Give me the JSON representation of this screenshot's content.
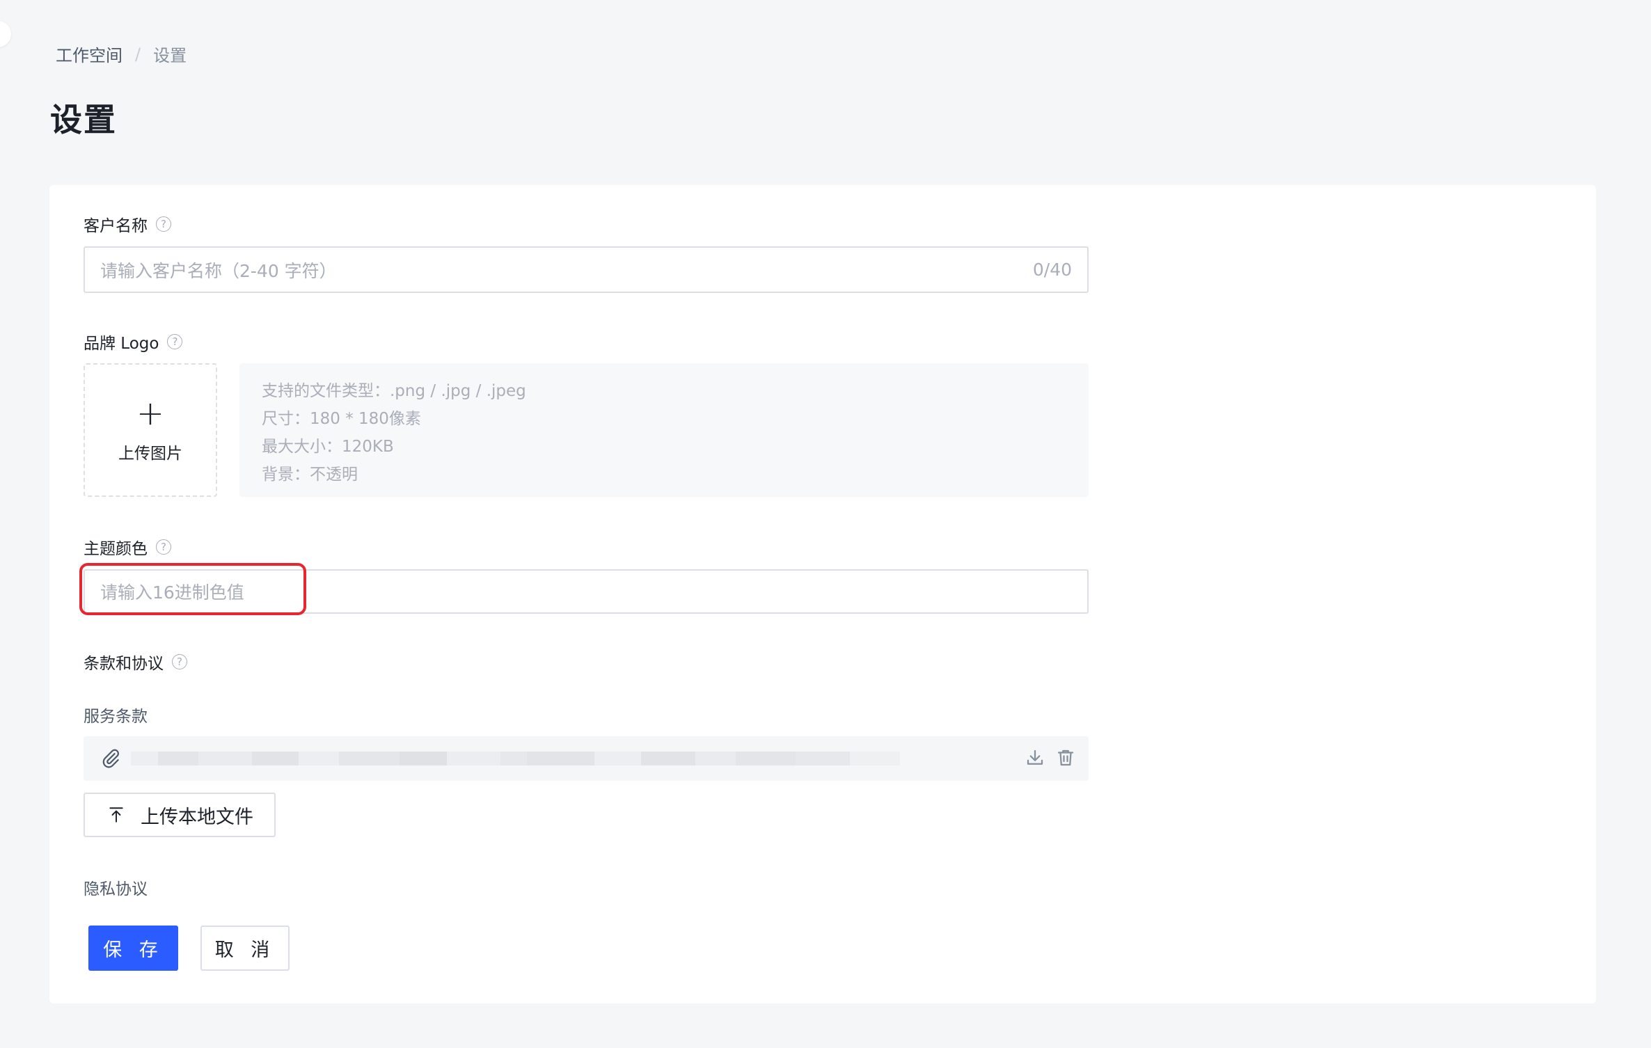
{
  "breadcrumb": {
    "root": "工作空间",
    "separator": "/",
    "current": "设置"
  },
  "page_title": "设置",
  "form": {
    "customer_name": {
      "label": "客户名称",
      "placeholder": "请输入客户名称（2-40 字符）",
      "counter": "0/40"
    },
    "brand_logo": {
      "label": "品牌 Logo",
      "upload_plus": "+",
      "upload_label": "上传图片",
      "tips": [
        "支持的文件类型：.png / .jpg / .jpeg",
        "尺寸：180 * 180像素",
        "最大大小：120KB",
        "背景：不透明"
      ]
    },
    "theme_color": {
      "label": "主题颜色",
      "placeholder": "请输入16进制色值"
    },
    "terms": {
      "label": "条款和协议",
      "service_terms_label": "服务条款",
      "upload_button_label": "上传本地文件",
      "privacy_label": "隐私协议"
    }
  },
  "actions": {
    "save_label": "保 存",
    "cancel_label": "取 消"
  },
  "colors": {
    "primary": "#2b5cff",
    "highlight": "#e8262f",
    "background": "#f5f6f8"
  },
  "icons": {
    "help": "question-circle-icon",
    "attachment": "paperclip-icon",
    "download": "download-icon",
    "delete": "trash-icon",
    "upload": "upload-icon"
  },
  "help_glyph": "?"
}
